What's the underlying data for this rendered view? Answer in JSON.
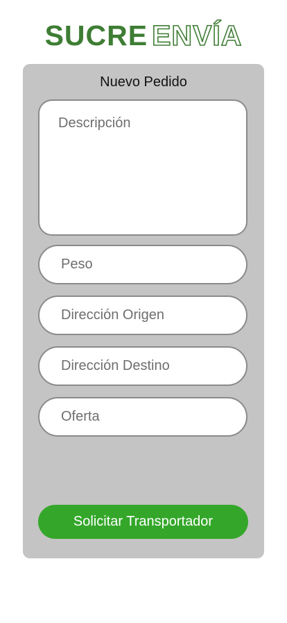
{
  "logo": {
    "part1": "SUCRE",
    "part2": "ENVÍA"
  },
  "form": {
    "title": "Nuevo Pedido",
    "description_placeholder": "Descripción",
    "weight_placeholder": "Peso",
    "origin_placeholder": "Dirección Origen",
    "destination_placeholder": "Dirección Destino",
    "offer_placeholder": "Oferta",
    "submit_label": "Solicitar Transportador"
  },
  "colors": {
    "brand_green": "#3e7d34",
    "button_green": "#34a72a",
    "panel_gray": "#c4c4c4"
  }
}
